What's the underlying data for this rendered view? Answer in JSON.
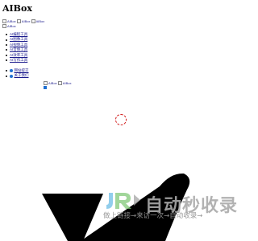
{
  "site": {
    "title": "AIBox"
  },
  "header_images": [
    {
      "alt": "AIBox"
    },
    {
      "alt": "AIBox"
    },
    {
      "alt": "AIBox"
    }
  ],
  "logo_image": {
    "alt": "AIBox"
  },
  "menu_primary": [
    {
      "label": "AI编程工具"
    },
    {
      "label": "AI图像工具"
    },
    {
      "label": "AI视频工具"
    },
    {
      "label": "AI音频工具"
    },
    {
      "label": "AI效率工具"
    },
    {
      "label": "AI写作工具"
    }
  ],
  "menu_secondary": [
    {
      "label": "网站提交",
      "icon": "blue-circle-icon",
      "color": "#1f6fd1"
    },
    {
      "label": "关于我们",
      "icon": "blue-circle-icon",
      "color": "#1f6fd1"
    }
  ],
  "content_images": [
    {
      "alt": "AIBox"
    },
    {
      "alt": "AIBox"
    }
  ],
  "watermark": {
    "title": "自动秒收录",
    "subtitle": "做上链接→来访一次→自动收录→"
  },
  "colors": {
    "link": "#1a1a8c",
    "spinner": "#d11a1a",
    "accent_blue": "#1f6fd1",
    "watermark_gray": "#aaaaaa"
  }
}
